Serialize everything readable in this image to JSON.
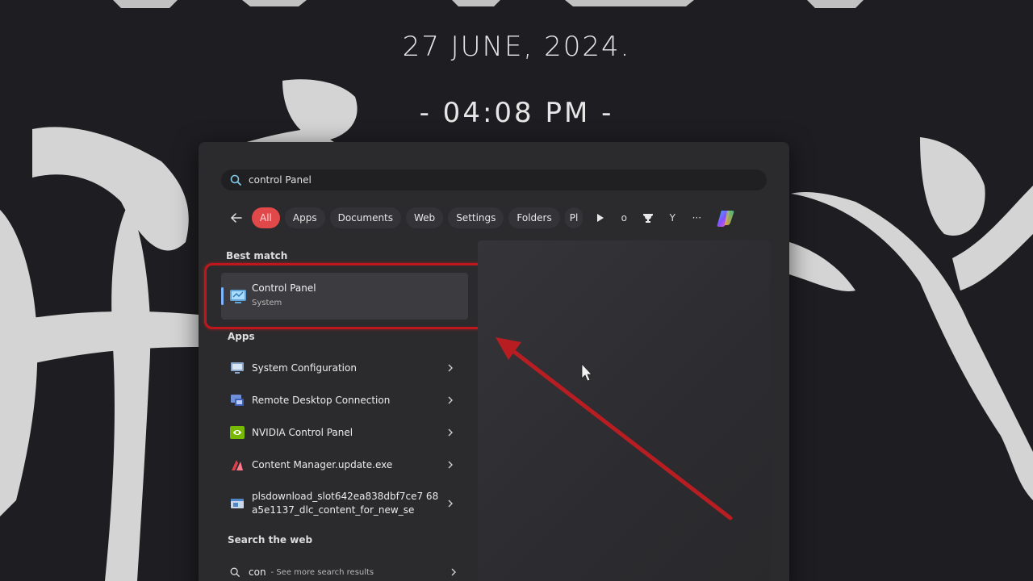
{
  "clock": {
    "date": "27 JUNE, 2024.",
    "time": "- 04:08 PM -"
  },
  "search": {
    "value": "control Panel",
    "icon": "search-icon"
  },
  "filters": {
    "back_icon": "arrow-left-icon",
    "chips": [
      "All",
      "Apps",
      "Documents",
      "Web",
      "Settings",
      "Folders",
      "Pl"
    ],
    "active": "All",
    "more": "···",
    "o_label": "o",
    "y_label": "Y"
  },
  "best_match": {
    "title": "Best match",
    "app_name": "Control Panel",
    "app_type": "System"
  },
  "apps": {
    "title": "Apps",
    "items": [
      {
        "label": "System Configuration"
      },
      {
        "label": "Remote Desktop Connection"
      },
      {
        "label": "NVIDIA Control Panel"
      },
      {
        "label": "Content Manager.update.exe"
      },
      {
        "label": "plsdownload_slot642ea838dbf7ce7 68a5e1137_dlc_content_for_new_se"
      }
    ]
  },
  "web": {
    "title": "Search the web",
    "query": "con",
    "hint": "- See more search results"
  },
  "colors": {
    "accent_active_chip": "#e0484a",
    "annotation_red": "#c0171d",
    "panel_bg": "#2b2b2e"
  }
}
